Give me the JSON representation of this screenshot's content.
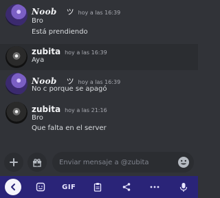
{
  "messages": [
    {
      "author": "Noob",
      "author_glyph": "ツ",
      "time": "hoy a las 16:39",
      "lines": [
        "Bro",
        "Está prendiendo"
      ]
    },
    {
      "author": "zubita",
      "time": "hoy a las 16:39",
      "lines": [
        "Aya"
      ]
    },
    {
      "author": "Noob",
      "author_glyph": "ツ",
      "time": "hoy a las 16:39",
      "lines": [
        "No c porque se apagó"
      ]
    },
    {
      "author": "zubita",
      "time": "hoy a las 21:16",
      "lines": [
        "Bro",
        "Que falta en el server"
      ]
    }
  ],
  "composer": {
    "placeholder": "Enviar mensaje a @zubita",
    "icons": {
      "add": "plus-icon",
      "gift": "gift-icon",
      "emoji": "emoji-icon"
    }
  },
  "keyboard_bar": {
    "gif_label": "GIF",
    "icons": [
      "back-icon",
      "sticker-icon",
      "gif",
      "clipboard-icon",
      "share-icon",
      "more-icon",
      "mic-icon"
    ]
  },
  "colors": {
    "background": "#313338",
    "highlight_row": "#2b2d31",
    "keyboard_bar": "#2a2478"
  }
}
